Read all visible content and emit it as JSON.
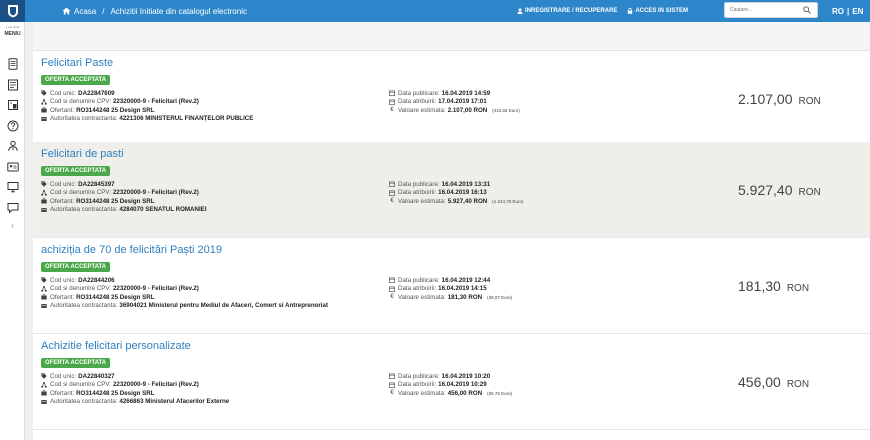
{
  "header": {
    "breadcrumb": [
      "Acasa",
      "Achizitii Initiate din catalogul electronic"
    ],
    "register_label": "INREGISTRARE / RECUPERARE",
    "login_label": "ACCES IN SISTEM",
    "search_placeholder": "Cautare...",
    "lang_ro": "RO",
    "lang_sep": "|",
    "lang_en": "EN"
  },
  "sidebar": {
    "toggle_small": "« ascunde",
    "toggle_label": "MENIU",
    "icons": [
      "document-icon",
      "list-icon",
      "building-icon",
      "help-icon",
      "user-tie-icon",
      "id-card-icon",
      "monitor-icon",
      "chat-icon"
    ],
    "expand_icon": "chevron-right-icon"
  },
  "labels": {
    "cod_unic": "Cod unic:",
    "cpv": "Cod si denumire CPV:",
    "ofertant": "Ofertant:",
    "autoritate": "Autoritatea contractanta:",
    "data_publicare": "Data publicare:",
    "data_atribuirii": "Data atribuirii:",
    "valoare": "Valoare estimata:"
  },
  "items": [
    {
      "title": "Felicitari Paste",
      "status": "OFERTA ACCEPTATA",
      "cod_unic": "DA22847609",
      "cpv": "22320000-9 - Felicitari (Rev.2)",
      "ofertant": "RO3144248 25 Design SRL",
      "autoritate": "4221306 MINISTERUL FINANȚELOR PUBLICE",
      "data_publicare": "16.04.2019 14:59",
      "data_atribuirii": "17.04.2019 17:01",
      "valoare": "2.107,00 RON",
      "valoare_eur": "(442,66 Euro)",
      "price": "2.107,00",
      "currency": "RON"
    },
    {
      "title": "Felicitari de pasti",
      "status": "OFERTA ACCEPTATA",
      "cod_unic": "DA22845397",
      "cpv": "22320000-9 - Felicitari (Rev.2)",
      "ofertant": "RO3144248 25 Design SRL",
      "autoritate": "4284070 SENATUL ROMANIEI",
      "data_publicare": "16.04.2019 13:31",
      "data_atribuirii": "16.04.2019 16:13",
      "valoare": "5.927,40 RON",
      "valoare_eur": "(1.244,76 Euro)",
      "price": "5.927,40",
      "currency": "RON"
    },
    {
      "title": "achiziția de 70 de felicitări Paști 2019",
      "status": "OFERTA ACCEPTATA",
      "cod_unic": "DA22844206",
      "cpv": "22320000-9 - Felicitari (Rev.2)",
      "ofertant": "RO3144248 25 Design SRL",
      "autoritate": "36904021 Ministerul pentru Mediul de Afaceri, Comert si Antreprenoriat",
      "data_publicare": "16.04.2019 12:44",
      "data_atribuirii": "16.04.2019 14:15",
      "valoare": "181,30 RON",
      "valoare_eur": "(38,07 Euro)",
      "price": "181,30",
      "currency": "RON"
    },
    {
      "title": "Achizitie felicitari personalizate",
      "status": "OFERTA ACCEPTATA",
      "cod_unic": "DA22840327",
      "cpv": "22320000-9 - Felicitari (Rev.2)",
      "ofertant": "RO3144248 25 Design SRL",
      "autoritate": "4266863 Ministerul Afacerilor Externe",
      "data_publicare": "16.04.2019 10:20",
      "data_atribuirii": "16.04.2019 10:29",
      "valoare": "456,00 RON",
      "valoare_eur": "(95,76 Euro)",
      "price": "456,00",
      "currency": "RON"
    }
  ],
  "colors": {
    "topbar": "#2d86c9",
    "logo_bg": "#1b4f86",
    "title_link": "#2f7fbf",
    "badge_green": "#4aa84a",
    "highlight_row": "#efeeea"
  }
}
